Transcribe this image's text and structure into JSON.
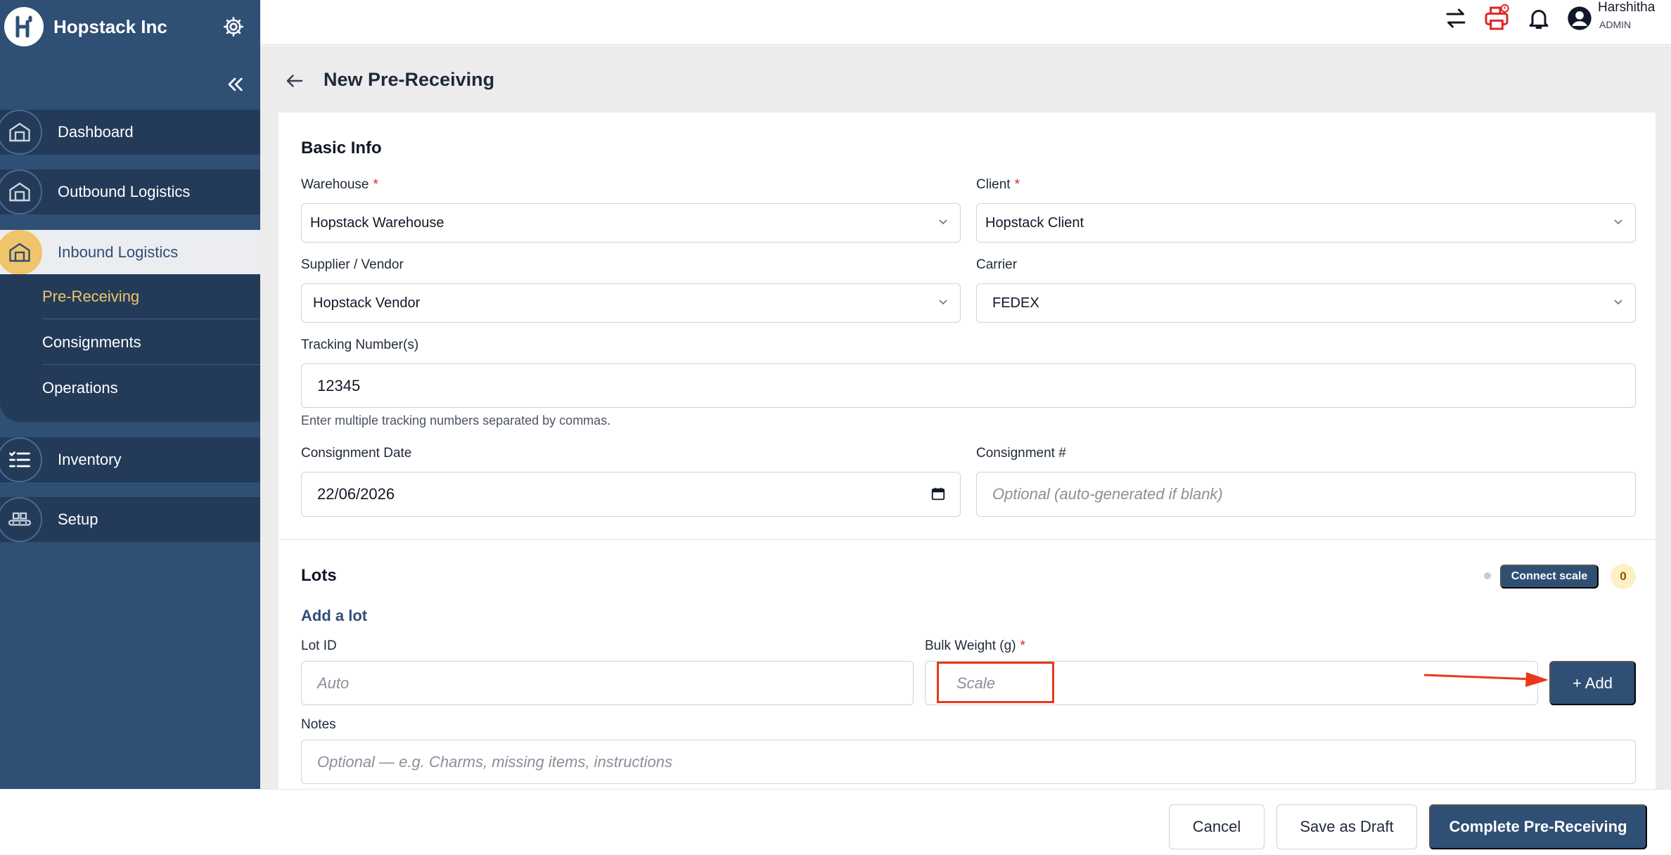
{
  "sidebar": {
    "brand_name": "Hopstack Inc",
    "nav": [
      {
        "label": "Dashboard",
        "icon": "warehouse-icon"
      },
      {
        "label": "Outbound Logistics",
        "icon": "warehouse-icon"
      },
      {
        "label": "Inbound Logistics",
        "icon": "warehouse-icon"
      },
      {
        "label": "Inventory",
        "icon": "checklist-icon"
      },
      {
        "label": "Setup",
        "icon": "conveyor-icon"
      }
    ],
    "submenu": [
      "Pre-Receiving",
      "Consignments",
      "Operations"
    ]
  },
  "topbar": {
    "user_name": "Harshitha",
    "user_role": "ADMIN",
    "icons": [
      "switch-arrows-icon",
      "printer-alert-icon",
      "bell-icon",
      "user-circle-icon"
    ]
  },
  "page": {
    "title": "New Pre-Receiving"
  },
  "basic_info": {
    "title": "Basic Info",
    "warehouse_label": "Warehouse",
    "warehouse_value": "Hopstack Warehouse",
    "client_label": "Client",
    "client_value": "Hopstack Client",
    "supplier_label": "Supplier / Vendor",
    "supplier_value": "Hopstack Vendor",
    "carrier_label": "Carrier",
    "carrier_value": "FEDEX",
    "tracking_label": "Tracking Number(s)",
    "tracking_value": "12345",
    "tracking_hint": "Enter multiple tracking numbers separated by commas.",
    "date_label": "Consignment Date",
    "date_value": "22/06/2026",
    "consignment_no_label": "Consignment #",
    "consignment_no_placeholder": "Optional (auto-generated if blank)",
    "required_mark": "*"
  },
  "lots": {
    "title": "Lots",
    "connect_scale_label": "Connect scale",
    "scale_count": "0",
    "add_lot_title": "Add a lot",
    "lot_id_label": "Lot ID",
    "lot_id_placeholder": "Auto",
    "bulk_weight_label": "Bulk Weight (g)",
    "bulk_weight_placeholder": "Scale",
    "add_button": "+ Add",
    "notes_label": "Notes",
    "notes_placeholder": "Optional — e.g. Charms, missing items, instructions"
  },
  "footer": {
    "cancel": "Cancel",
    "save_draft": "Save as Draft",
    "complete": "Complete Pre-Receiving"
  },
  "colors": {
    "sidebar": "#2f4f74",
    "sidebar_dark": "#233b59",
    "accent": "#f0c46a",
    "primary_button": "#2f4f74",
    "annotation": "#e8391a"
  }
}
